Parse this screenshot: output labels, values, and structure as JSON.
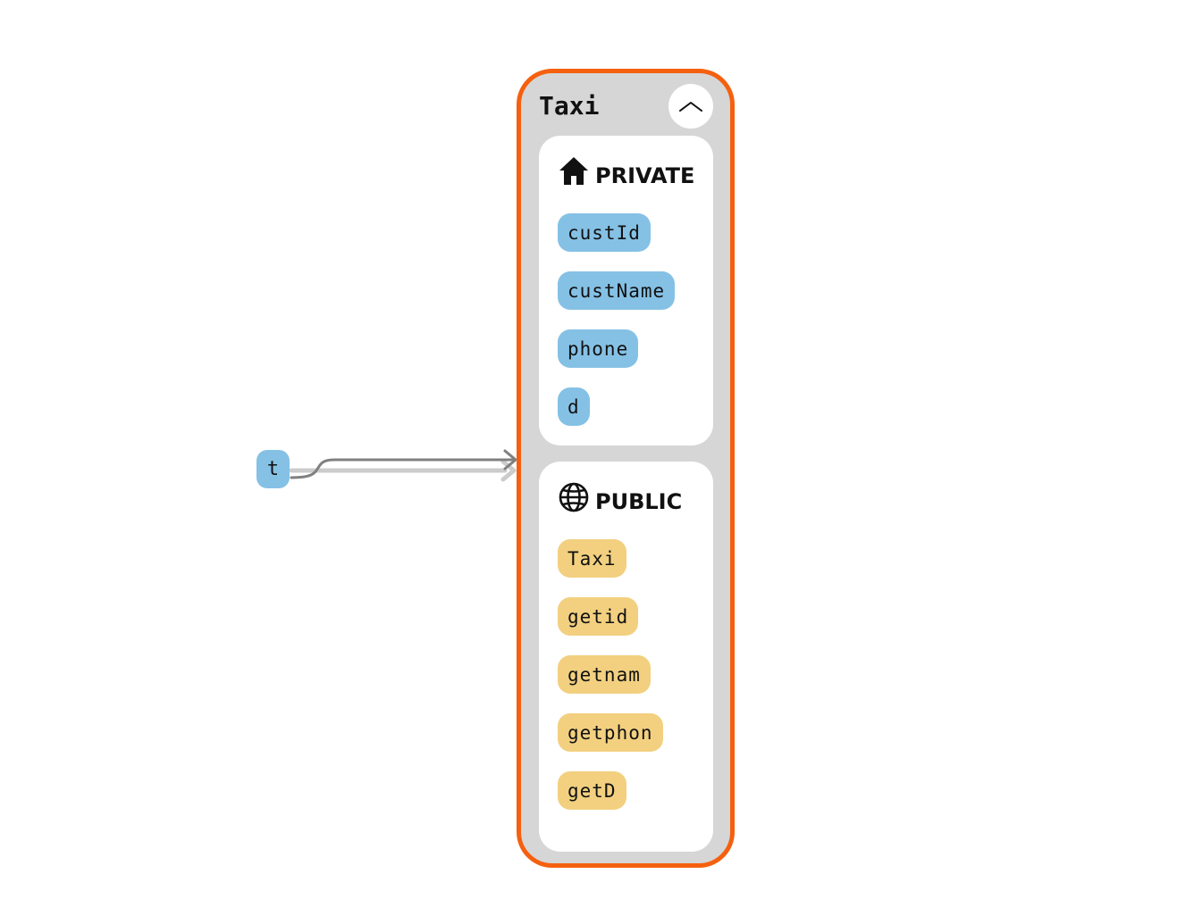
{
  "variable": {
    "name": "t"
  },
  "class": {
    "name": "Taxi",
    "collapse_icon": "chevron-up-icon",
    "private": {
      "label": "PRIVATE",
      "icon": "house-icon",
      "color": "#85c1e5",
      "members": [
        "custId",
        "custName",
        "phone",
        "d"
      ]
    },
    "public": {
      "label": "PUBLIC",
      "icon": "globe-icon",
      "color": "#f2d080",
      "members": [
        "Taxi",
        "getid",
        "getnam",
        "getphon",
        "getD"
      ]
    }
  },
  "colors": {
    "class_border": "#f5600f",
    "class_background": "#d6d6d6",
    "arrow": "#808080"
  }
}
